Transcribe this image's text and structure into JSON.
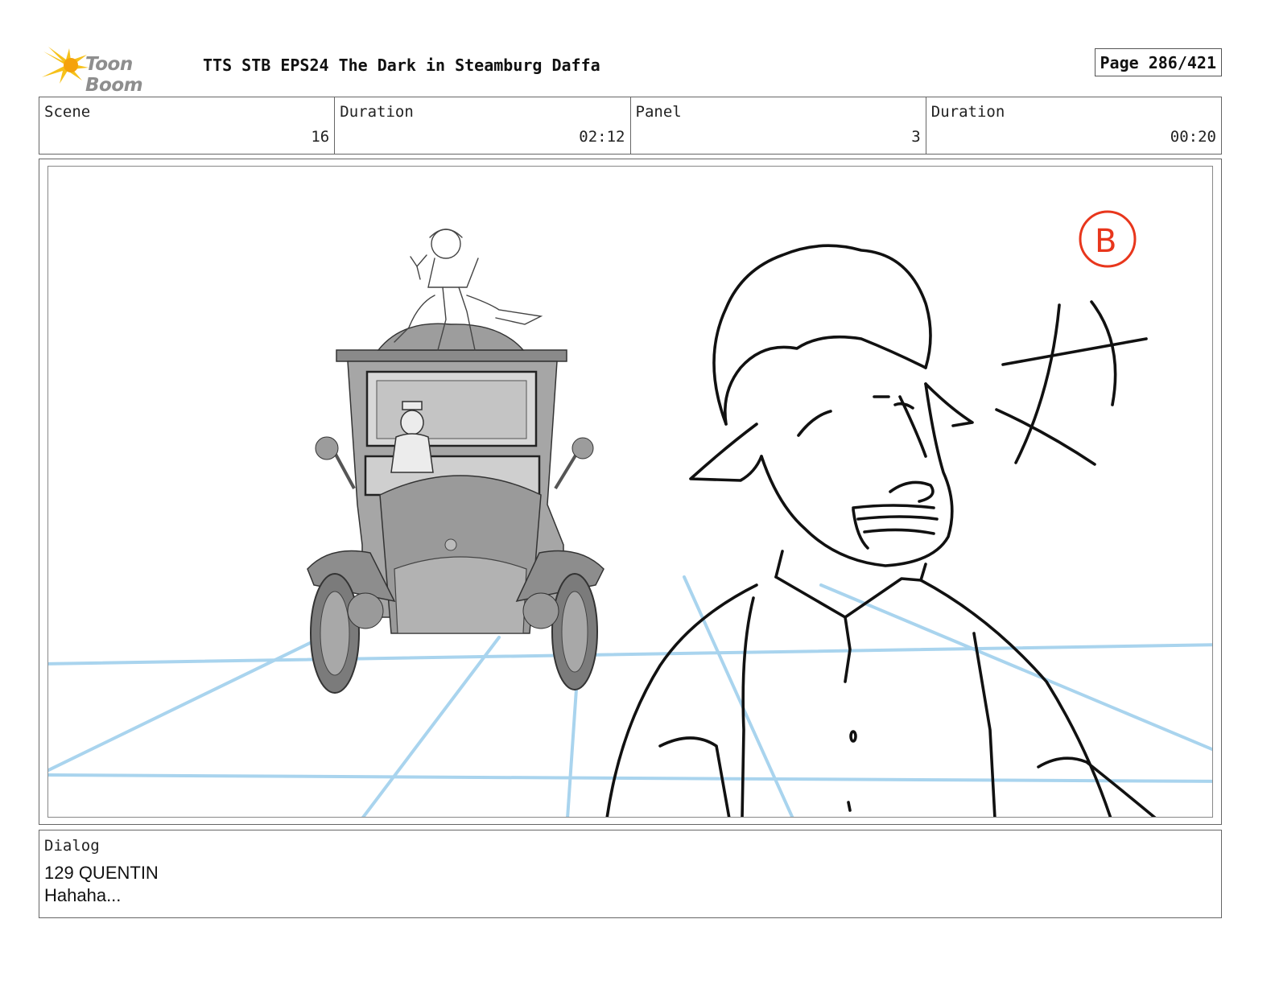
{
  "header": {
    "logo_text": "Toon Boom",
    "title": "TTS STB EPS24 The Dark in Steamburg Daffa",
    "page": "Page 286/421"
  },
  "info": {
    "scene_label": "Scene",
    "scene_value": "16",
    "scene_duration_label": "Duration",
    "scene_duration_value": "02:12",
    "panel_label": "Panel",
    "panel_value": "3",
    "panel_duration_label": "Duration",
    "panel_duration_value": "00:20"
  },
  "panel": {
    "marker": "B",
    "marker_color": "#e8361c",
    "grid_color": "#a9d4ee"
  },
  "dialog": {
    "label": "Dialog",
    "line1": "129 QUENTIN",
    "line2": "Hahaha..."
  }
}
